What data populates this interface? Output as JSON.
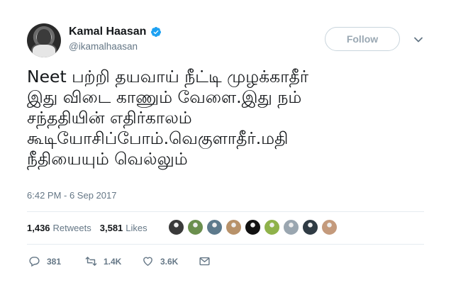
{
  "author": {
    "display_name": "Kamal Haasan",
    "handle": "@ikamalhaasan",
    "verified": true
  },
  "follow_button": {
    "label": "Follow"
  },
  "tweet": {
    "text": "Neet பற்றி தயவாய் நீட்டி முழக்காதீர்\nஇது விடை காணும் வேளை.இது நம்\nசந்ததியின் எதிர்காலம்\nகூடியோசிப்போம்.வெகுளாதீர்.மதி\nநீதியையும் வெல்லும்",
    "timestamp": "6:42 PM - 6 Sep 2017"
  },
  "stats": {
    "retweets_count": "1,436",
    "retweets_label": "Retweets",
    "likes_count": "3,581",
    "likes_label": "Likes"
  },
  "likers": [
    {
      "color": "#3a3a3a"
    },
    {
      "color": "#6b8f4e"
    },
    {
      "color": "#5d7a8c"
    },
    {
      "color": "#b8926a"
    },
    {
      "color": "#111111"
    },
    {
      "color": "#8fb24a"
    },
    {
      "color": "#9aa6b0"
    },
    {
      "color": "#2f3b44"
    },
    {
      "color": "#c49a7c"
    }
  ],
  "actions": {
    "reply": {
      "icon": "reply-icon",
      "count": "381"
    },
    "retweet": {
      "icon": "retweet-icon",
      "count": "1.4K"
    },
    "like": {
      "icon": "heart-icon",
      "count": "3.6K"
    },
    "message": {
      "icon": "envelope-icon"
    }
  },
  "colors": {
    "text": "#14171a",
    "secondary": "#657786",
    "verified": "#1da1f2",
    "divider": "#e6ecf0"
  }
}
